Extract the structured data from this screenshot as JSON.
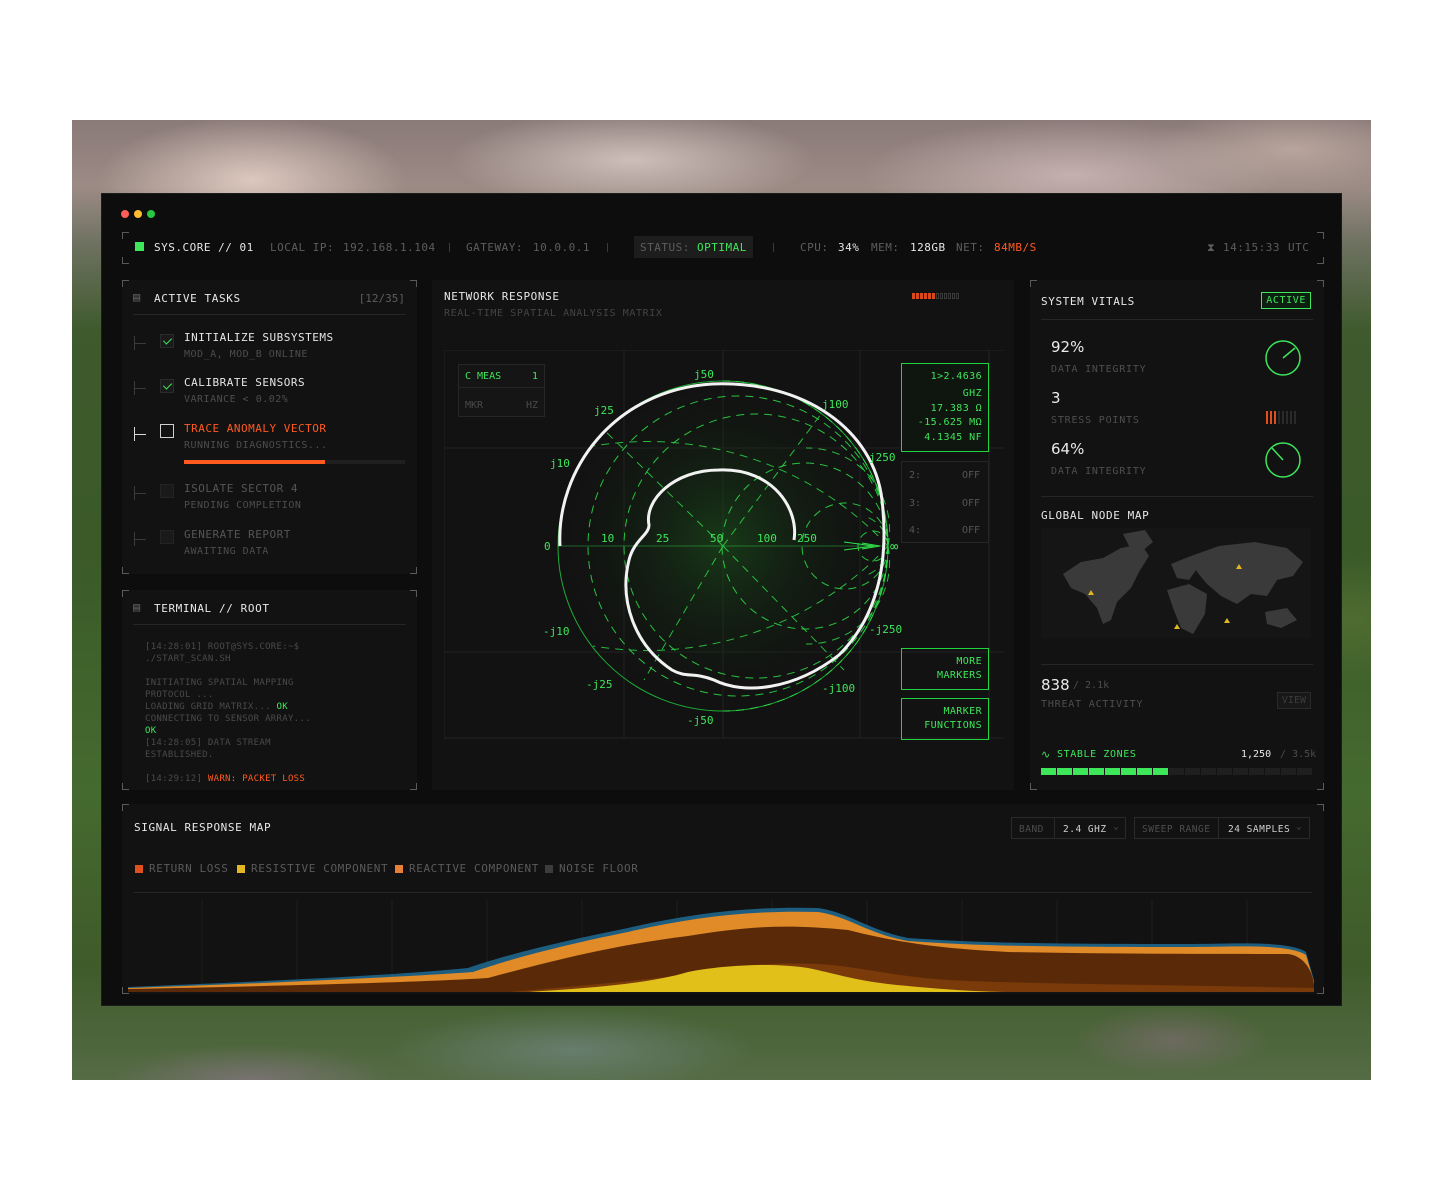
{
  "window_dots": [
    "close",
    "minimize",
    "maximize"
  ],
  "status_bar": {
    "system": "SYS.CORE // 01",
    "local_ip_label": "LOCAL IP:",
    "local_ip": "192.168.1.104",
    "gateway_label": "GATEWAY:",
    "gateway": "10.0.0.1",
    "status_label": "STATUS:",
    "status": "OPTIMAL",
    "cpu_label": "CPU:",
    "cpu": "34%",
    "mem_label": "MEM:",
    "mem": "128GB",
    "net_label": "NET:",
    "net": "84MB/S",
    "time": "14:15:33",
    "tz": "UTC",
    "clock_icon": "hourglass-icon"
  },
  "tasks": {
    "title": "ACTIVE TASKS",
    "count": "[12/35]",
    "icon": "clipboard-icon",
    "items": [
      {
        "title": "INITIALIZE SUBSYSTEMS",
        "sub": "MOD_A, MOD_B ONLINE",
        "state": "done"
      },
      {
        "title": "CALIBRATE SENSORS",
        "sub": "VARIANCE < 0.02%",
        "state": "done"
      },
      {
        "title": "TRACE ANOMALY VECTOR",
        "sub": "RUNNING DIAGNOSTICS...",
        "state": "active",
        "progress": 0.64
      },
      {
        "title": "ISOLATE SECTOR 4",
        "sub": "PENDING COMPLETION",
        "state": "pending"
      },
      {
        "title": "GENERATE REPORT",
        "sub": "AWAITING DATA",
        "state": "pending"
      }
    ]
  },
  "terminal": {
    "title": "TERMINAL // ROOT",
    "icon": "clipboard-icon",
    "lines": [
      {
        "text": "[14:28:01] ROOT@SYS.CORE:~$"
      },
      {
        "text": "./START_SCAN.SH"
      },
      {
        "text": ""
      },
      {
        "text": "INITIATING SPATIAL MAPPING"
      },
      {
        "text": "PROTOCOL ..."
      },
      {
        "text": "LOADING GRID MATRIX...",
        "tag": "OK"
      },
      {
        "text": "CONNECTING TO SENSOR ARRAY..."
      },
      {
        "text": "",
        "tag": "OK"
      },
      {
        "text": "[14:28:05] DATA STREAM"
      },
      {
        "text": "ESTABLISHED."
      },
      {
        "text": ""
      },
      {
        "text": "[14:29:12]",
        "warn": "WARN: PACKET LOSS"
      }
    ]
  },
  "network": {
    "title": "NETWORK RESPONSE",
    "subtitle": "REAL-TIME SPATIAL ANALYSIS MATRIX",
    "meas_table": {
      "header_left": "C MEAS",
      "header_right": "1",
      "col_left": "MKR",
      "col_right": "HZ"
    },
    "marker1": [
      "1>2.4636",
      "GHZ",
      "17.383 Ω",
      "-15.625 MΩ",
      "4.1345 NF"
    ],
    "markers": [
      {
        "id": "2:",
        "state": "OFF"
      },
      {
        "id": "3:",
        "state": "OFF"
      },
      {
        "id": "4:",
        "state": "OFF"
      }
    ],
    "more_markers": [
      "MORE",
      "MARKERS"
    ],
    "marker_functions": [
      "MARKER",
      "FUNCTIONS"
    ],
    "smith_labels": {
      "j50": "j50",
      "j25": "j25",
      "j100": "j100",
      "j10": "j10",
      "j250": "j250",
      "zero": "0",
      "r10": "10",
      "r25": "25",
      "r50": "50",
      "r100": "100",
      "r250": "250",
      "inf": "∞",
      "mj10": "-j10",
      "mj250": "-j250",
      "mj25": "-j25",
      "mj100": "-j100",
      "mj50": "-j50"
    }
  },
  "vitals": {
    "title": "SYSTEM VITALS",
    "badge": "ACTIVE",
    "items": [
      {
        "value": "92%",
        "label": "DATA INTEGRITY",
        "gauge": "dial",
        "level": 0.92
      },
      {
        "value": "3",
        "label": "STRESS POINTS",
        "gauge": "bars",
        "level": 3
      },
      {
        "value": "64%",
        "label": "DATA INTEGRITY",
        "gauge": "dial",
        "level": 0.64
      }
    ]
  },
  "node_map": {
    "title": "GLOBAL NODE MAP",
    "threat_value": "838",
    "threat_total": "/ 2.1k",
    "threat_label": "THREAT ACTIVITY",
    "view_button": "VIEW",
    "stable_label": "STABLE ZONES",
    "stable_value": "1,250",
    "stable_total": "/ 3.5k",
    "stable_level": 0.357,
    "stable_icon": "pulse-icon"
  },
  "signal": {
    "title": "SIGNAL RESPONSE MAP",
    "band_label": "BAND",
    "band_value": "2.4 GHZ",
    "sweep_label": "SWEEP RANGE",
    "sweep_value": "24 SAMPLES",
    "legend": [
      {
        "name": "RETURN LOSS",
        "color": "#e0501e"
      },
      {
        "name": "RESISTIVE COMPONENT",
        "color": "#e2b820"
      },
      {
        "name": "REACTIVE COMPONENT",
        "color": "#e8803a"
      },
      {
        "name": "NOISE FLOOR",
        "color": "#3c3c3c"
      }
    ]
  },
  "colors": {
    "accent_green": "#3ee65a",
    "accent_orange": "#ff5a1f",
    "panel_bg": "#121212",
    "window_bg": "#0d0d0d"
  }
}
